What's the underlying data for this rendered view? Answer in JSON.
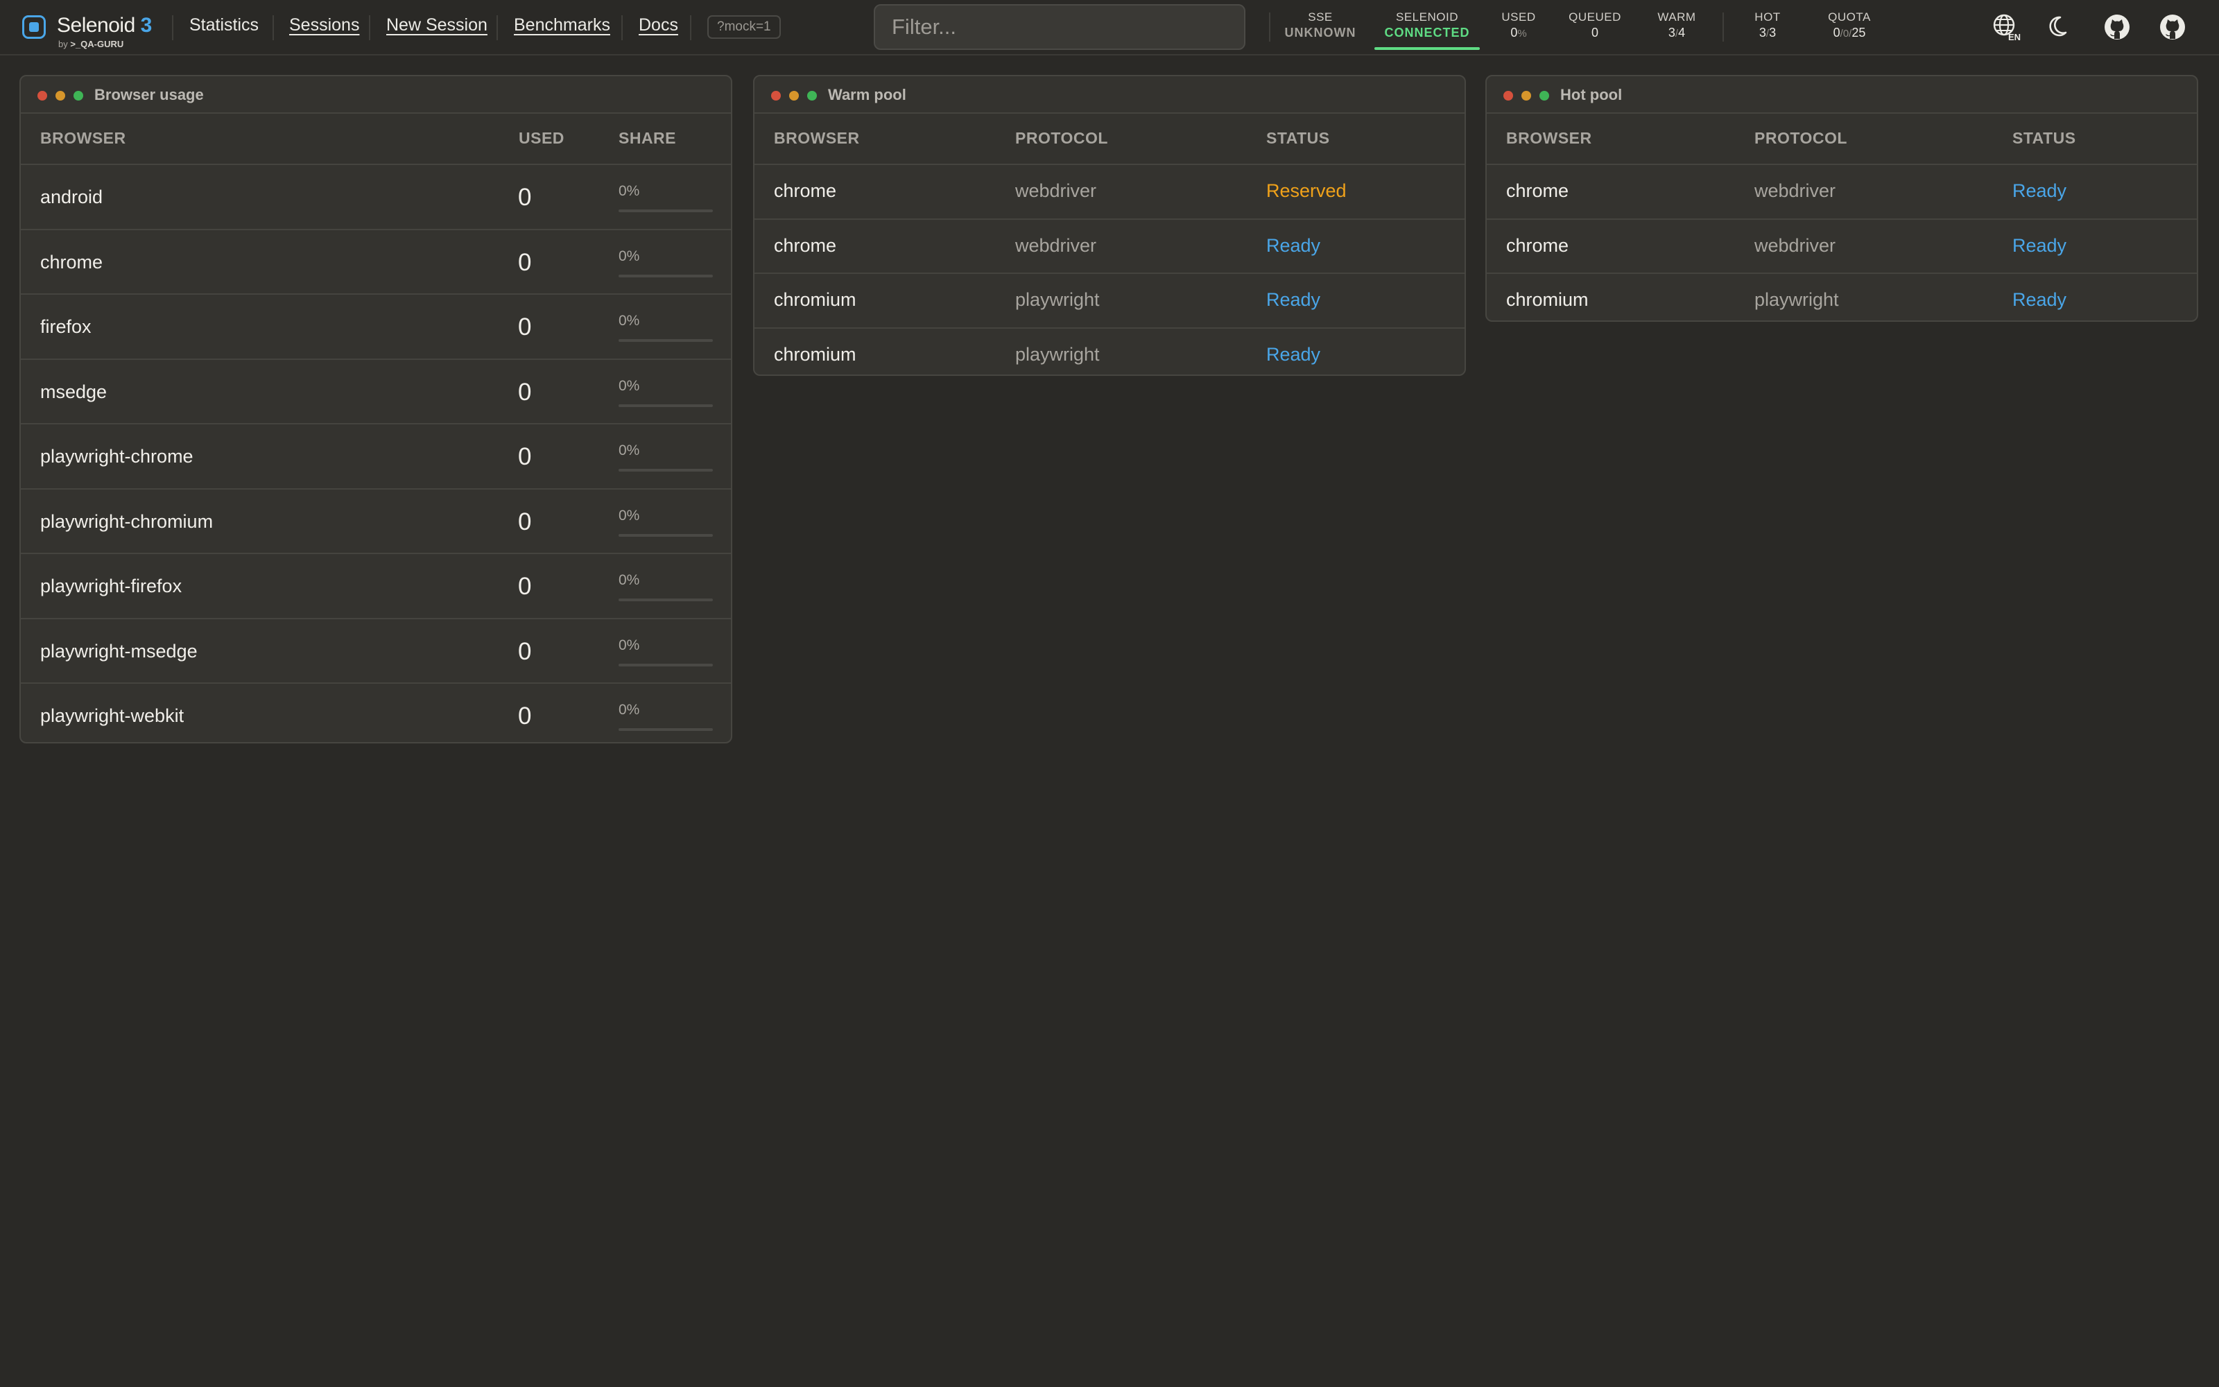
{
  "header": {
    "app_name": "Selenoid",
    "app_version": "3",
    "by_prefix": "by",
    "by_name": ">_QA-GURU",
    "nav": [
      {
        "label": "Statistics"
      },
      {
        "label": "Sessions"
      },
      {
        "label": "New Session"
      },
      {
        "label": "Benchmarks"
      },
      {
        "label": "Docs"
      }
    ],
    "mock_badge": "?mock=1",
    "filter_placeholder": "Filter...",
    "stats": {
      "sse": {
        "label": "SSE",
        "value": "UNKNOWN"
      },
      "selenoid": {
        "label": "SELENOID",
        "value": "CONNECTED"
      },
      "used": {
        "label": "USED",
        "value": "0",
        "unit": "%"
      },
      "queued": {
        "label": "QUEUED",
        "value": "0"
      },
      "warm": {
        "label": "WARM",
        "a": "3",
        "sep": "/",
        "b": "4"
      },
      "hot": {
        "label": "HOT",
        "a": "3",
        "sep": "/",
        "b": "3"
      },
      "quota": {
        "label": "QUOTA",
        "a": "0",
        "sep1": "/",
        "b": "0",
        "sep2": "/",
        "c": "25"
      }
    },
    "language": "EN",
    "icons": [
      "globe-icon",
      "moon-icon",
      "github-icon",
      "github-icon"
    ]
  },
  "browser_usage": {
    "title": "Browser usage",
    "columns": [
      "BROWSER",
      "USED",
      "SHARE"
    ],
    "rows": [
      {
        "browser": "android",
        "used": "0",
        "share": "0%",
        "share_fraction": 0
      },
      {
        "browser": "chrome",
        "used": "0",
        "share": "0%",
        "share_fraction": 0
      },
      {
        "browser": "firefox",
        "used": "0",
        "share": "0%",
        "share_fraction": 0
      },
      {
        "browser": "msedge",
        "used": "0",
        "share": "0%",
        "share_fraction": 0
      },
      {
        "browser": "playwright-chrome",
        "used": "0",
        "share": "0%",
        "share_fraction": 0
      },
      {
        "browser": "playwright-chromium",
        "used": "0",
        "share": "0%",
        "share_fraction": 0
      },
      {
        "browser": "playwright-firefox",
        "used": "0",
        "share": "0%",
        "share_fraction": 0
      },
      {
        "browser": "playwright-msedge",
        "used": "0",
        "share": "0%",
        "share_fraction": 0
      },
      {
        "browser": "playwright-webkit",
        "used": "0",
        "share": "0%",
        "share_fraction": 0
      }
    ]
  },
  "warm_pool": {
    "title": "Warm pool",
    "columns": [
      "BROWSER",
      "PROTOCOL",
      "STATUS"
    ],
    "rows": [
      {
        "browser": "chrome",
        "protocol": "webdriver",
        "status": "Reserved"
      },
      {
        "browser": "chrome",
        "protocol": "webdriver",
        "status": "Ready"
      },
      {
        "browser": "chromium",
        "protocol": "playwright",
        "status": "Ready"
      },
      {
        "browser": "chromium",
        "protocol": "playwright",
        "status": "Ready"
      }
    ]
  },
  "hot_pool": {
    "title": "Hot pool",
    "columns": [
      "BROWSER",
      "PROTOCOL",
      "STATUS"
    ],
    "rows": [
      {
        "browser": "chrome",
        "protocol": "webdriver",
        "status": "Ready"
      },
      {
        "browser": "chrome",
        "protocol": "webdriver",
        "status": "Ready"
      },
      {
        "browser": "chromium",
        "protocol": "playwright",
        "status": "Ready"
      }
    ]
  },
  "colors": {
    "background": "#2a2926",
    "panel": "#34332f",
    "accent": "#4aa6e8",
    "connected": "#5fdc84",
    "reserved": "#f0a21a"
  }
}
